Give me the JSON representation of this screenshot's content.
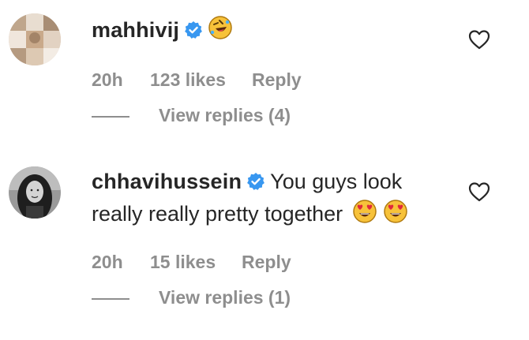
{
  "comments": [
    {
      "username": "mahhivij",
      "verified": true,
      "text": "",
      "emojis": [
        "rolling-on-floor-laughing-emoji"
      ],
      "time": "20h",
      "likes": "123 likes",
      "reply": "Reply",
      "view_replies": "View replies (4)"
    },
    {
      "username": "chhavihussein",
      "verified": true,
      "text_line1": "You guys look",
      "text_line2": "really really pretty together",
      "emojis": [
        "heart-eyes-emoji",
        "heart-eyes-emoji"
      ],
      "time": "20h",
      "likes": "15 likes",
      "reply": "Reply",
      "view_replies": "View replies (1)"
    }
  ],
  "colors": {
    "text": "#262626",
    "secondary": "#8e8e8e",
    "verified": "#3897f0",
    "emoji_face": "#f7c23a"
  }
}
